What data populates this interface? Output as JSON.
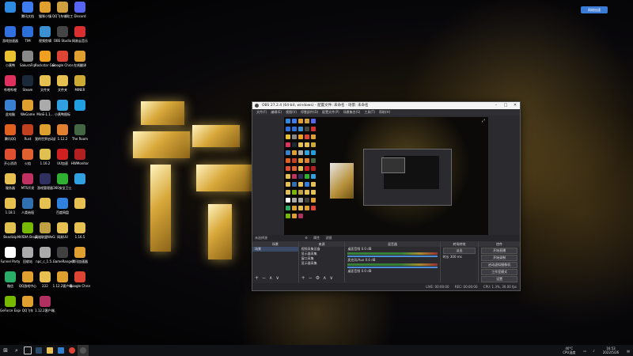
{
  "desktop": {
    "icons": [
      {
        "label": "",
        "color": "#2d8ae0"
      },
      {
        "label": "腾讯文档",
        "color": "#3d7bf0"
      },
      {
        "label": "猫咪小镇",
        "color": "#e0a030"
      },
      {
        "label": "QQ飞车辅助工具",
        "color": "#d0a040"
      },
      {
        "label": "Discord",
        "color": "#5865f2"
      },
      {
        "label": "游戏加速器",
        "color": "#3070e0"
      },
      {
        "label": "TIM",
        "color": "#2d6fd8"
      },
      {
        "label": "视频剪辑",
        "color": "#3a90d0"
      },
      {
        "label": "OBS Studio",
        "color": "#444444"
      },
      {
        "label": "网易云音乐",
        "color": "#d83030"
      },
      {
        "label": "小黄鸭",
        "color": "#e8c030"
      },
      {
        "label": "SakuraFrp",
        "color": "#888888"
      },
      {
        "label": "Rockstar Games L...",
        "color": "#f0a020"
      },
      {
        "label": "Google Chrome",
        "color": "#dd4433"
      },
      {
        "label": "在线翻译",
        "color": "#e0a030"
      },
      {
        "label": "哔哩哔哩",
        "color": "#e03060"
      },
      {
        "label": "Steam",
        "color": "#1b2838"
      },
      {
        "label": "文件夹",
        "color": "#e6c050"
      },
      {
        "label": "文件夹",
        "color": "#e6c050"
      },
      {
        "label": "MINER",
        "color": "#ccaa33"
      },
      {
        "label": "此电脑",
        "color": "#3a80d0"
      },
      {
        "label": "WeGame",
        "color": "#e0a030"
      },
      {
        "label": "MinE-1.1...",
        "color": "#aaaaaa"
      },
      {
        "label": "小黄鸭图标",
        "color": "#30a0e0"
      },
      {
        "label": "",
        "color": "#20a0e0"
      },
      {
        "label": "腾讯QQ",
        "color": "#e06020"
      },
      {
        "label": "Rust",
        "color": "#c04020"
      },
      {
        "label": "我的世界启动器",
        "color": "#e0a030"
      },
      {
        "label": "1.12.2",
        "color": "#e08030"
      },
      {
        "label": "The Room",
        "color": "#446644"
      },
      {
        "label": "开心消消",
        "color": "#e05030"
      },
      {
        "label": "火焰",
        "color": "#e06030"
      },
      {
        "label": "1.16.2",
        "color": "#e0c050"
      },
      {
        "label": "UU加速",
        "color": "#d02020"
      },
      {
        "label": "HWMonitor",
        "color": "#b02020"
      },
      {
        "label": "服务器",
        "color": "#e6c050"
      },
      {
        "label": "MTS开发",
        "color": "#c03060"
      },
      {
        "label": "游戏管理器",
        "color": "#303060"
      },
      {
        "label": "360安全卫士",
        "color": "#30b030"
      },
      {
        "label": "",
        "color": "#30a0e0"
      },
      {
        "label": "1.18.1",
        "color": "#e6c050"
      },
      {
        "label": "人类始祖",
        "color": "#3070b0"
      },
      {
        "label": "",
        "color": "#e6c050"
      },
      {
        "label": "百度网盘",
        "color": "#3080e0"
      },
      {
        "label": "",
        "color": "#e6c050"
      },
      {
        "label": "Bandizip",
        "color": "#e0c050"
      },
      {
        "label": "NVIDIA Broadcast",
        "color": "#76b900"
      },
      {
        "label": "英雄联盟WeGame版",
        "color": "#c0a040"
      },
      {
        "label": "网易UU",
        "color": "#e6c050"
      },
      {
        "label": "1.16.5",
        "color": "#e6c050"
      },
      {
        "label": "Funnel Party",
        "color": "#ffffff"
      },
      {
        "label": "回收站",
        "color": "#aaaaaa"
      },
      {
        "label": "npc_c_1.5...",
        "color": "#aaaaaa"
      },
      {
        "label": "GameRange",
        "color": "#404040"
      },
      {
        "label": "腾讯加速器",
        "color": "#e0a030"
      },
      {
        "label": "微信",
        "color": "#2aae67"
      },
      {
        "label": "QQ游戏中心",
        "color": "#e0a030"
      },
      {
        "label": "222",
        "color": "#e6c050"
      },
      {
        "label": "1.12.2客户端",
        "color": "#e0a030"
      },
      {
        "label": "Google Chrome",
        "color": "#dd4433"
      },
      {
        "label": "GeForce Experience",
        "color": "#76b900"
      },
      {
        "label": "QQ飞车",
        "color": "#e0a030"
      },
      {
        "label": "1.12.2客户端.rar",
        "color": "#b03060"
      }
    ]
  },
  "obs": {
    "title": "OBS 27.2.4 (64-bit, windows) - 配置文件: 未命名 - 场景: 未命名",
    "menu": [
      "文件(F)",
      "编辑(E)",
      "视图(V)",
      "停靠部件(D)",
      "配置文件(P)",
      "场景集合(S)",
      "工具(T)",
      "帮助(H)"
    ],
    "dock_header": "未选择源",
    "dock_header_btns": [
      "属性",
      "滤镜"
    ],
    "docks": {
      "scenes": {
        "title": "场景",
        "items": [
          "场景"
        ]
      },
      "sources": {
        "title": "来源",
        "items": [
          "视频采集设备",
          "显示器采集",
          "窗口采集",
          "显示器采集"
        ]
      },
      "mixer": {
        "title": "混音器",
        "channels": [
          "桌面音频",
          "麦克风/Aux",
          "桌面音频"
        ],
        "levels": [
          "0.0 dB",
          "0.0 dB",
          "0.0 dB"
        ]
      },
      "transitions": {
        "title": "转场特效",
        "type": "淡出",
        "duration_label": "时长",
        "duration": "300 ms"
      },
      "controls": {
        "title": "控件",
        "buttons": [
          "开始直播",
          "开始录制",
          "启动虚拟摄像机",
          "工作室模式",
          "设置",
          "退出"
        ]
      }
    },
    "status": [
      "LIVE: 00:00:00",
      "REC: 00:00:00",
      "CPU: 1.3%, 30.00 fps"
    ]
  },
  "taskbar": {
    "start_icon": "windows-icon",
    "search_icon": "search-icon",
    "tray_temp": "40°C",
    "tray_temp_sub": "CPU温度",
    "clock_time": "16:53",
    "clock_date": "2022/5/26"
  },
  "corner_badge": "网络加速"
}
